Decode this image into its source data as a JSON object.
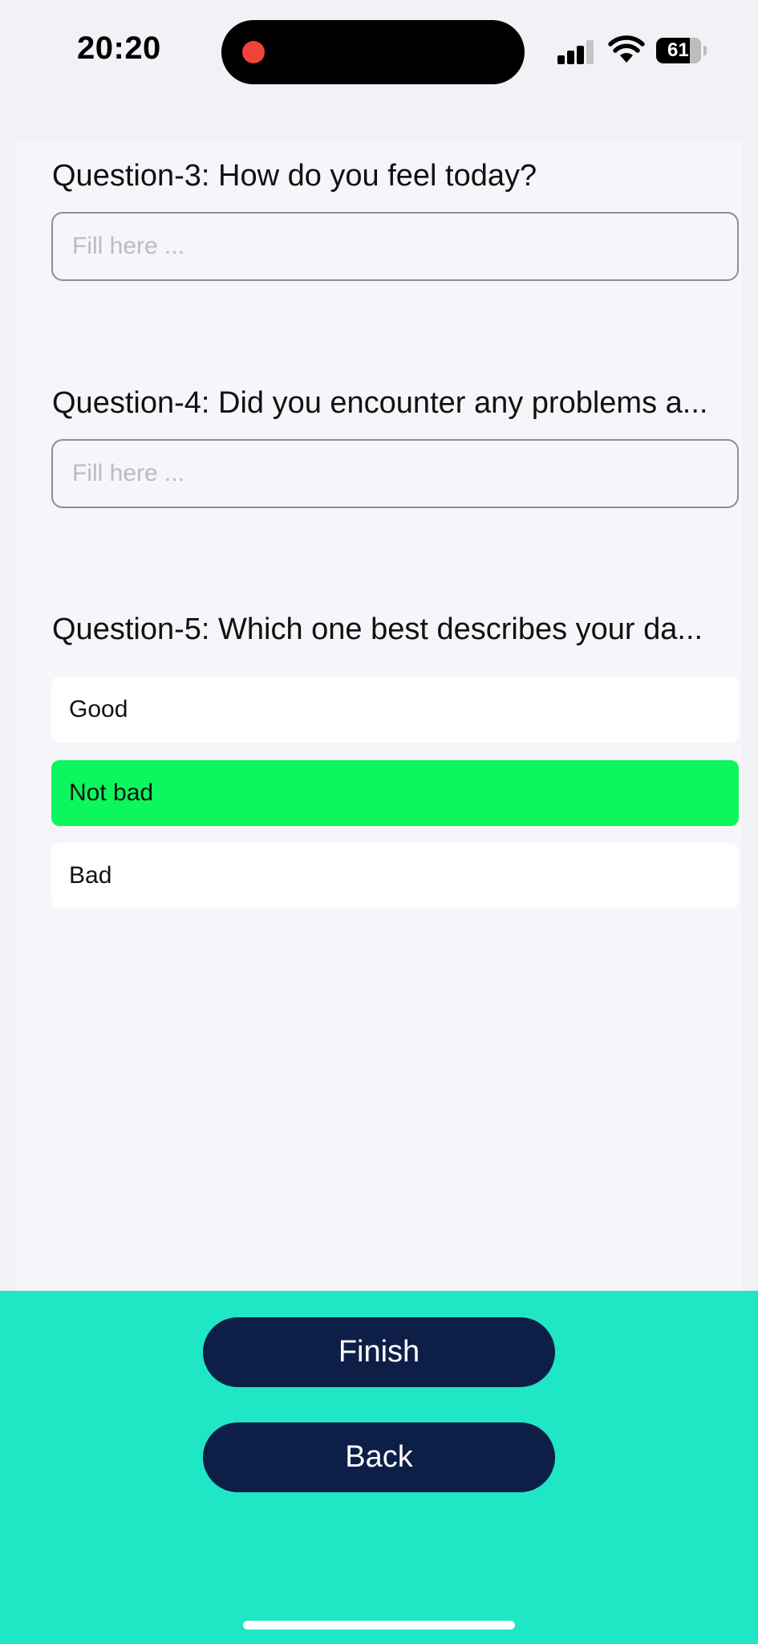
{
  "status_bar": {
    "time": "20:20",
    "battery": "61",
    "icons": [
      "recording-dot",
      "cellular-signal-icon",
      "wifi-icon",
      "battery-icon"
    ]
  },
  "questions": [
    {
      "label": "Question-3: How do you feel today?",
      "placeholder": "Fill here ...",
      "type": "text"
    },
    {
      "label": "Question-4: Did you encounter any problems a...",
      "placeholder": "Fill here ...",
      "type": "text"
    },
    {
      "label": "Question-5: Which one best describes your da...",
      "type": "choice",
      "options": [
        "Good",
        "Not bad",
        "Bad"
      ],
      "selected": "Not bad"
    }
  ],
  "actions": {
    "finish": "Finish",
    "back": "Back"
  },
  "colors": {
    "selected_option": "#0cf65d",
    "bottom_bar": "#1fe6c5",
    "button": "#0e1f47",
    "recording_dot": "#f0443a"
  }
}
